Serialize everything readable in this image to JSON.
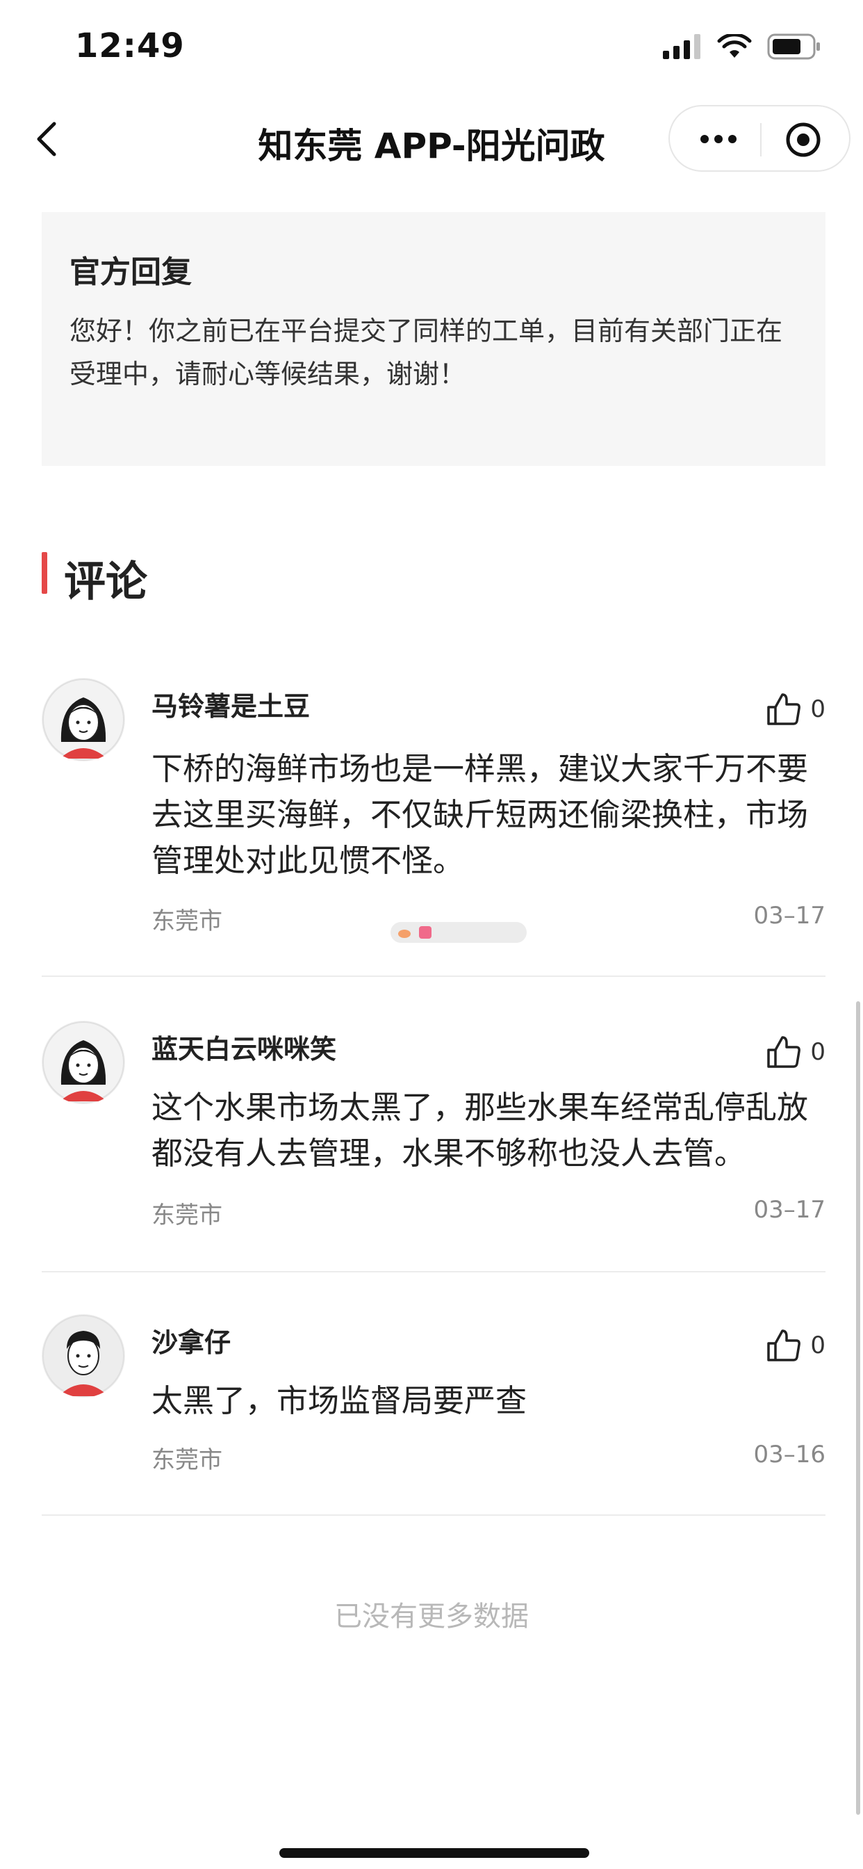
{
  "status_bar": {
    "time": "12:49"
  },
  "nav": {
    "title": "知东莞 APP-阳光问政",
    "icons": {
      "back": "chevron-left-icon",
      "more": "more-dots-icon",
      "close": "target-close-icon"
    }
  },
  "official_reply": {
    "title": "官方回复",
    "body": "您好！你之前已在平台提交了同样的工单，目前有关部门正在受理中，请耐心等候结果，谢谢！"
  },
  "comments_section": {
    "title": "评论",
    "accent_color": "#e54848"
  },
  "comments": [
    {
      "user": "马铃薯是土豆",
      "avatar": "female-avatar",
      "likes": "0",
      "text": "下桥的海鲜市场也是一样黑，建议大家千万不要去这里买海鲜，不仅缺斤短两还偷梁换柱，市场管理处对此见惯不怪。",
      "location": "东莞市",
      "date": "03–17"
    },
    {
      "user": "蓝天白云咪咪笑",
      "avatar": "female-avatar",
      "likes": "0",
      "text": "这个水果市场太黑了，那些水果车经常乱停乱放都没有人去管理，水果不够称也没人去管。",
      "location": "东莞市",
      "date": "03–17"
    },
    {
      "user": "沙拿仔",
      "avatar": "male-avatar",
      "likes": "0",
      "text": "太黑了，市场监督局要严查",
      "location": "东莞市",
      "date": "03–16"
    }
  ],
  "footer": {
    "no_more": "已没有更多数据"
  }
}
